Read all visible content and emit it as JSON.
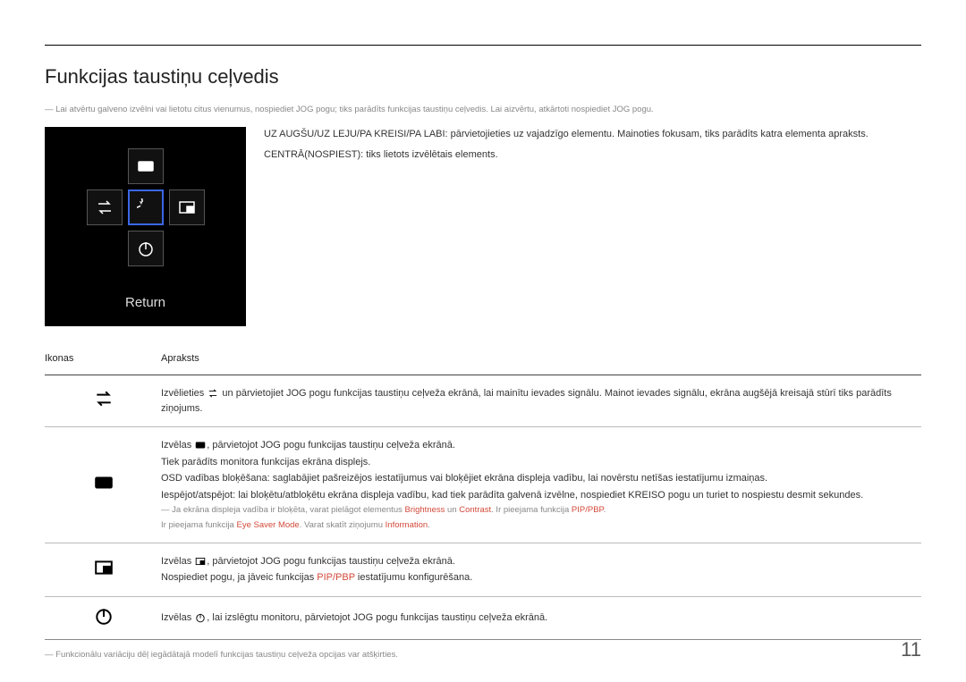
{
  "title": "Funkcijas taustiņu ceļvedis",
  "intro_note": "Lai atvērtu galveno izvēlni vai lietotu citus vienumus, nospiediet JOG pogu; tiks parādīts funkcijas taustiņu ceļvedis. Lai aizvērtu, atkārtoti nospiediet JOG pogu.",
  "guide_text_p1": "UZ AUGŠU/UZ LEJU/PA KREISI/PA LABI: pārvietojieties uz vajadzīgo elementu. Mainoties fokusam, tiks parādīts katra elementa apraksts.",
  "guide_text_p2": "CENTRĀ(NOSPIEST): tiks lietots izvēlētais elements.",
  "return_label": "Return",
  "table": {
    "header_icons": "Ikonas",
    "header_desc": "Apraksts",
    "row1_a": "Izvēlieties ",
    "row1_b": " un pārvietojiet JOG pogu funkcijas taustiņu ceļveža ekrānā, lai mainītu ievades signālu. Mainot ievades signālu, ekrāna augšējā kreisajā stūrī tiks parādīts ziņojums.",
    "row2_a": "Izvēlas ",
    "row2_b": ", pārvietojot JOG pogu funkcijas taustiņu ceļveža ekrānā.",
    "row2_p2": "Tiek parādīts monitora funkcijas ekrāna displejs.",
    "row2_p3": "OSD vadības bloķēšana: saglabājiet pašreizējos iestatījumus vai bloķējiet ekrāna displeja vadību, lai novērstu netīšas iestatījumu izmaiņas.",
    "row2_p4": "Iespējot/atspējot: lai bloķētu/atbloķētu ekrāna displeja vadību, kad tiek parādīta galvenā izvēlne, nospiediet KREISO pogu un turiet to nospiestu desmit sekundes.",
    "row2_note1_a": "Ja ekrāna displeja vadība ir bloķēta, varat pielāgot elementus ",
    "row2_note1_b": " un ",
    "row2_note1_c": ". Ir pieejama funkcija ",
    "row2_note1_d": ".",
    "row2_note2_a": "Ir pieejama funkcija ",
    "row2_note2_b": ". Varat skatīt ziņojumu ",
    "row2_note2_c": ".",
    "row2_red_brightness": "Brightness",
    "row2_red_contrast": "Contrast",
    "row2_red_pip": "PIP/PBP",
    "row2_red_eyesaver": "Eye Saver Mode",
    "row2_red_information": "Information",
    "row3_a": "Izvēlas ",
    "row3_b": ", pārvietojot JOG pogu funkcijas taustiņu ceļveža ekrānā.",
    "row3_p2_a": "Nospiediet pogu, ja jāveic funkcijas ",
    "row3_p2_b": " iestatījumu konfigurēšana.",
    "row3_red_pip": "PIP/PBP",
    "row4_a": "Izvēlas ",
    "row4_b": ", lai izslēgtu monitoru, pārvietojot JOG pogu funkcijas taustiņu ceļveža ekrānā."
  },
  "footer_note": "Funkcionālu variāciju dēļ iegādātajā modelī funkcijas taustiņu ceļveža opcijas var atšķirties.",
  "page_number": "11"
}
